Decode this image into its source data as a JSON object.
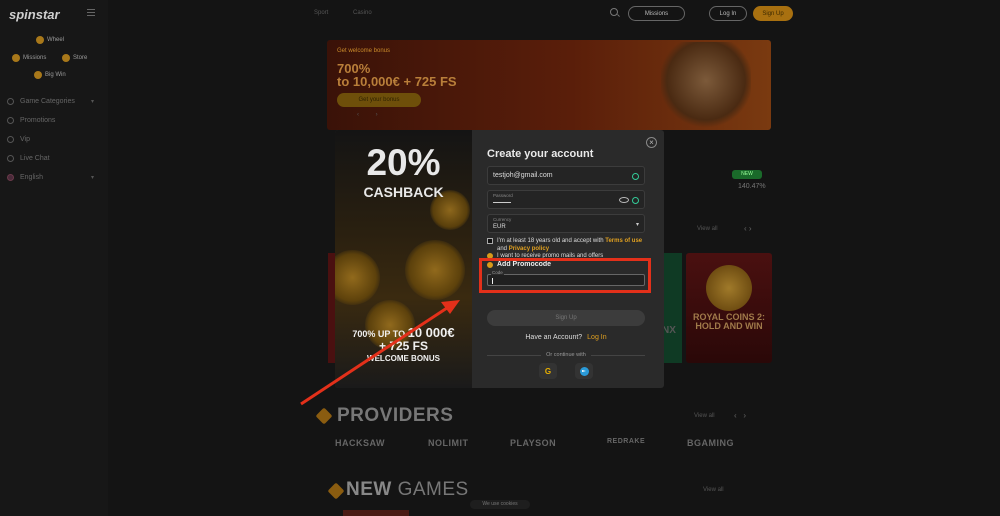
{
  "app": {
    "logo": "spinstar"
  },
  "sidebar": {
    "chips": [
      "Wheel",
      "Missions",
      "Store",
      "Big Win"
    ],
    "nav": [
      {
        "label": "Game Categories",
        "has_chevron": true
      },
      {
        "label": "Promotions",
        "has_chevron": false
      },
      {
        "label": "Vip",
        "has_chevron": false
      },
      {
        "label": "Live Chat",
        "has_chevron": false
      },
      {
        "label": "English",
        "has_chevron": true
      }
    ]
  },
  "topbar": {
    "tabs": [
      "Sport",
      "Casino"
    ],
    "missions_label": "Missions",
    "login_label": "Log In",
    "signup_label": "Sign Up"
  },
  "hero": {
    "small_label": "Get welcome bonus",
    "line1": "700%",
    "line2": "to 10,000€ + 725 FS",
    "button": "Get your bonus"
  },
  "background": {
    "badge": "NEW",
    "rate": "140.47%",
    "view_all": "View all",
    "game_card": "ROYAL COINS 2: HOLD AND WIN",
    "nx_text": "NX",
    "providers_title": "PROVIDERS",
    "providers": [
      "HACKSAW",
      "NOLIMIT",
      "PLAYSON",
      "REDRAKE",
      "BGAMING"
    ],
    "new_games_title_bold": "NEW",
    "new_games_title_thin": "GAMES",
    "cookie": "We use cookies"
  },
  "modal": {
    "promo": {
      "percent": "20%",
      "sub": "CASHBACK",
      "line1_small": "700% UP TO",
      "line1_big": "10 000€",
      "line2": "+ 725 FS",
      "line3": "WELCOME BONUS"
    },
    "title": "Create your account",
    "email_value": "testjoh@gmail.com",
    "password_label": "Password",
    "currency_label": "Currency",
    "currency_value": "EUR",
    "age_text": "I'm at least 18 years old and accept with",
    "terms_link": "Terms of use",
    "and_text": "and",
    "privacy_link": "Privacy policy",
    "promo_mail_text": "I want to receive promo mails and offers",
    "add_promocode": "Add Promocode",
    "code_label": "Code",
    "signup_button": "Sign Up",
    "have_account": "Have an Account?",
    "login_link": "Log In",
    "or_continue": "Or continue with",
    "close": "×"
  },
  "annotation": {
    "color": "#e3301a"
  }
}
